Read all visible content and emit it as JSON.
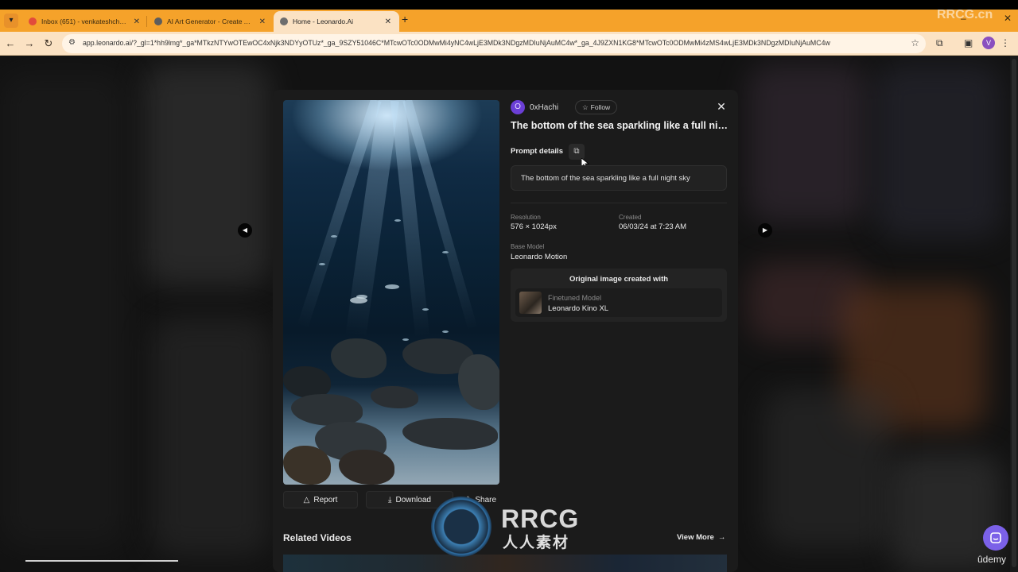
{
  "browser": {
    "tabs": [
      {
        "title": "Inbox (651) - venkateshchennu...",
        "favicon": "gmail-icon",
        "active": false
      },
      {
        "title": "AI Art Generator - Create Art, Im...",
        "favicon": "globe-icon",
        "active": false
      },
      {
        "title": "Home - Leonardo.Ai",
        "favicon": "leonardo-icon",
        "active": true
      }
    ],
    "url": "app.leonardo.ai/?_gl=1*hh9lmg*_ga*MTkzNTYwOTEwOC4xNjk3NDYyOTUz*_ga_9SZY51046C*MTcwOTc0ODMwMi4yNC4wLjE3MDk3NDgzMDIuNjAuMC4w*_ga_4J9ZXN1KG8*MTcwOTc0ODMwMi4zMS4wLjE3MDk3NDgzMDIuNjAuMC4w",
    "profile_initial": "V",
    "tab_bar_color": "#f5a22a"
  },
  "modal": {
    "author": {
      "avatar_letter": "O",
      "name": "0xHachi",
      "follow_label": "Follow"
    },
    "title": "The bottom of the sea sparkling like a full nig...",
    "prompt_label": "Prompt details",
    "prompt_text": "The bottom of the sea sparkling like a full night sky",
    "meta": {
      "resolution_label": "Resolution",
      "resolution_value": "576 × 1024px",
      "created_label": "Created",
      "created_value": "06/03/24 at 7:23 AM",
      "base_model_label": "Base Model",
      "base_model_value": "Leonardo Motion"
    },
    "original": {
      "heading": "Original image created with",
      "model_kind": "Finetuned Model",
      "model_name": "Leonardo Kino XL"
    },
    "actions": {
      "report": "Report",
      "download": "Download",
      "share": "Share"
    },
    "related": {
      "title": "Related Videos",
      "view_more": "View More"
    }
  },
  "overlay": {
    "udemy": "ûdemy",
    "watermark_top": "RRCG",
    "watermark_bottom": "人人素材",
    "corner_watermark": "RRCG.cn"
  }
}
